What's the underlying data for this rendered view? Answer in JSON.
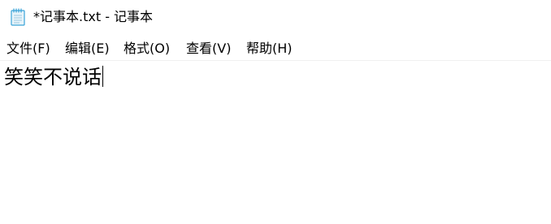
{
  "window": {
    "title": "*记事本.txt - 记事本",
    "icon": "notepad-icon"
  },
  "menu": {
    "items": [
      {
        "label": "文件(F)"
      },
      {
        "label": "编辑(E)"
      },
      {
        "label": "格式(O)"
      },
      {
        "label": "查看(V)"
      },
      {
        "label": "帮助(H)"
      }
    ]
  },
  "editor": {
    "content": "笑笑不说话"
  },
  "colors": {
    "background": "#ffffff",
    "text": "#000000",
    "icon_blue": "#3aa3d8",
    "icon_paper": "#e8f4fa"
  }
}
